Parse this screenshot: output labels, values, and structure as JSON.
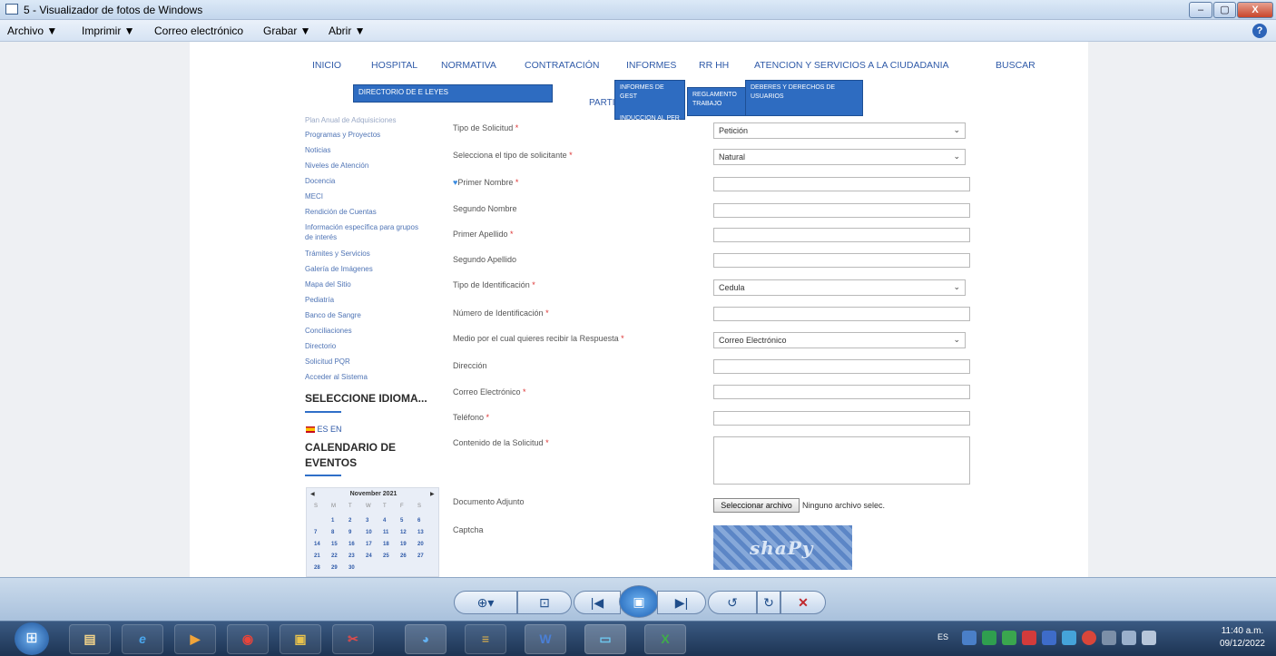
{
  "window": {
    "title": "5 - Visualizador de fotos de Windows",
    "btn_min": "–",
    "btn_max": "▢",
    "btn_close": "X"
  },
  "menubar": {
    "items": [
      "Archivo ▼",
      "Imprimir ▼",
      "Correo electrónico",
      "Grabar ▼",
      "Abrir ▼"
    ],
    "help": "?"
  },
  "web": {
    "nav": [
      "INICIO",
      "HOSPITAL",
      "NORMATIVA",
      "CONTRATACIÓN",
      "INFORMES",
      "RR HH",
      "ATENCION Y SERVICIOS A LA CIUDADANIA",
      "BUSCAR"
    ],
    "dropdowns": {
      "directorio": "DIRECTORIO DE E",
      "leyes": "LEYES",
      "informes_gest": "INFORMES DE GEST",
      "reglamento": "REGLAMENTO",
      "trabajo": "TRABAJO",
      "deberes": "DEBERES Y DERECHOS DE USUARIOS",
      "induccion": "INDUCCION AL PER",
      "partic": "PARTIC"
    },
    "sidebar": {
      "cut_item": "Plan Anual de Adquisiciones",
      "items": [
        "Programas y Proyectos",
        "Noticias",
        "Niveles de Atención",
        "Docencia",
        "MECI",
        "Rendición de Cuentas",
        "Información específica para grupos",
        "de interés",
        "Trámites y Servicios",
        "Galería de Imágenes",
        "Mapa del Sitio",
        "Pediatría",
        "Banco de Sangre",
        "Conciliaciones",
        "Directorio",
        "Solicitud PQR",
        "Acceder al Sistema"
      ],
      "lang_head": "SELECCIONE IDIOMA...",
      "lang_opts": "ES  EN",
      "cal_head_1": "CALENDARIO DE",
      "cal_head_2": "EVENTOS"
    },
    "calendar": {
      "month": "November 2021",
      "prev": "◀",
      "next": "▶",
      "weekdays": [
        "S",
        "M",
        "T",
        "W",
        "T",
        "F",
        "S"
      ],
      "rows": [
        [
          "",
          "1",
          "2",
          "3",
          "4",
          "5",
          "6"
        ],
        [
          "7",
          "8",
          "9",
          "10",
          "11",
          "12",
          "13"
        ],
        [
          "14",
          "15",
          "16",
          "17",
          "18",
          "19",
          "20"
        ],
        [
          "21",
          "22",
          "23",
          "24",
          "25",
          "26",
          "27"
        ],
        [
          "28",
          "29",
          "30",
          "",
          "",
          "",
          ""
        ]
      ]
    },
    "form": {
      "tipo_solicitud": {
        "label": "Tipo de Solicitud",
        "value": "Petición"
      },
      "tipo_solicitante": {
        "label": "Selecciona el tipo de solicitante",
        "value": "Natural"
      },
      "primer_nombre": {
        "label": "Primer Nombre"
      },
      "segundo_nombre": {
        "label": "Segundo Nombre"
      },
      "primer_apellido": {
        "label": "Primer Apellido"
      },
      "segundo_apellido": {
        "label": "Segundo Apellido"
      },
      "tipo_id": {
        "label": "Tipo de Identificación",
        "value": "Cedula"
      },
      "numero_id": {
        "label": "Número de Identificación"
      },
      "medio": {
        "label": "Medio por el cual quieres recibir la Respuesta",
        "value": "Correo Electrónico"
      },
      "direccion": {
        "label": "Dirección"
      },
      "correo": {
        "label": "Correo Electrónico"
      },
      "telefono": {
        "label": "Teléfono"
      },
      "contenido": {
        "label": "Contenido de la Solicitud"
      },
      "adjunto": {
        "label": "Documento Adjunto",
        "button": "Seleccionar archivo",
        "status": "Ninguno archivo selec."
      },
      "captcha": {
        "label": "Captcha",
        "text": "shaPy"
      },
      "required_mark": "*",
      "chevron": "⌄"
    }
  },
  "toolbar": {
    "zoom": "⊕▾",
    "fit": "⊡",
    "prev": "|◀",
    "slideshow": "▣",
    "next": "▶|",
    "rot_left": "↺",
    "rot_right": "↻",
    "delete": "✕"
  },
  "taskbar": {
    "start": "⊞",
    "apps": [
      "▤",
      "e",
      "▶",
      "◉",
      "▣",
      "✂",
      "◕",
      "≡",
      "W",
      "▭",
      "X"
    ],
    "lang": "ES",
    "clock_time": "11:40 a.m.",
    "clock_date": "09/12/2022"
  }
}
